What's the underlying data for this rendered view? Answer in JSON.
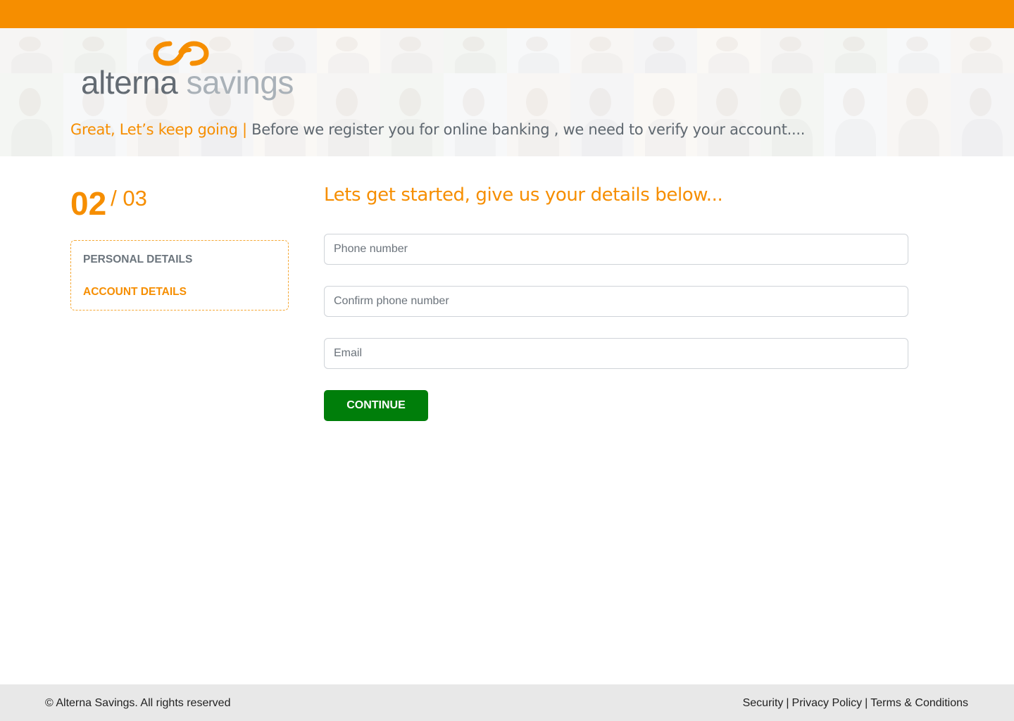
{
  "brand": {
    "name_part1": "alterna",
    "name_part2": "savings",
    "accent_color": "#f68e00",
    "primary_button_color": "#007e0a",
    "logo_icon": "interlocking-rings-icon"
  },
  "hero": {
    "accent_text": "Great, Let’s keep going",
    "separator": "|",
    "message": "Before we register you for online banking , we need to verify your account...."
  },
  "progress": {
    "current": "02",
    "total": "/ 03",
    "steps": [
      {
        "label": "PERSONAL DETAILS",
        "active": false
      },
      {
        "label": "ACCOUNT DETAILS",
        "active": true
      }
    ]
  },
  "form": {
    "title": "Lets  get started, give us your details below...",
    "fields": [
      {
        "placeholder": "Phone number",
        "value": ""
      },
      {
        "placeholder": "Confirm phone number",
        "value": ""
      },
      {
        "placeholder": "Email",
        "value": ""
      }
    ],
    "submit_label": "CONTINUE"
  },
  "footer": {
    "copyright": "© Alterna Savings. All rights reserved",
    "links": [
      "Security",
      "Privacy Policy",
      "Terms & Conditions"
    ],
    "separator": "|"
  }
}
